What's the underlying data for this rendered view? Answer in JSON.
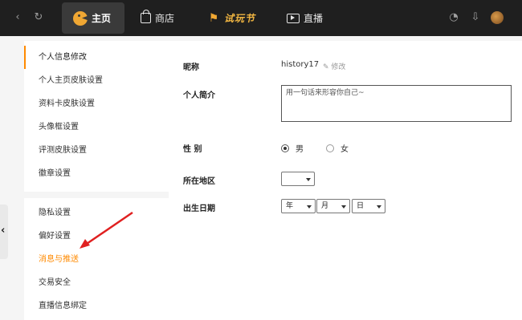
{
  "topbar": {
    "back_icon": "back-arrow-icon",
    "refresh_icon": "refresh-icon",
    "tabs": [
      {
        "label": "主页",
        "icon": "game-logo-icon"
      },
      {
        "label": "商店",
        "icon": "shopping-bag-icon"
      },
      {
        "label": "试玩节",
        "icon": "joystick-icon"
      },
      {
        "label": "直播",
        "icon": "play-video-icon"
      }
    ],
    "right_icons": [
      "controller-icon",
      "download-icon",
      "user-avatar"
    ]
  },
  "sidebar": {
    "group1": [
      "个人信息修改",
      "个人主页皮肤设置",
      "资料卡皮肤设置",
      "头像框设置",
      "评测皮肤设置",
      "徽章设置"
    ],
    "group2": [
      "隐私设置",
      "偏好设置",
      "消息与推送",
      "交易安全",
      "直播信息绑定"
    ],
    "active_item": "个人信息修改",
    "highlighted_item": "消息与推送",
    "accent_color": "#ff8a00"
  },
  "form": {
    "nickname_label": "昵称",
    "nickname_value": "history17",
    "edit_label": "修改",
    "bio_label": "个人简介",
    "bio_placeholder": "用一句话来形容你自己~",
    "gender_label": "性 别",
    "gender_male": "男",
    "gender_female": "女",
    "gender_selected": "男",
    "region_label": "所在地区",
    "region_value": "",
    "birth_label": "出生日期",
    "birth_year": "年",
    "birth_month": "月",
    "birth_day": "日"
  },
  "annotation": {
    "arrow_color": "#e02020"
  }
}
